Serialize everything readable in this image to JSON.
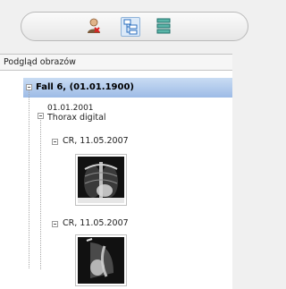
{
  "panel": {
    "title": "Podgląd obrazów"
  },
  "toolbar": {
    "icons": [
      "user-icon",
      "hierarchy-view-icon",
      "list-view-icon"
    ]
  },
  "tree": {
    "patient": {
      "label": "Fall 6,  (01.01.1900)"
    },
    "study": {
      "date": "01.01.2001",
      "description": "Thorax digital"
    },
    "series": [
      {
        "label": "CR, 11.05.2007",
        "thumbnail": "chest-xray-frontal"
      },
      {
        "label": "CR, 11.05.2007",
        "thumbnail": "chest-xray-lateral"
      }
    ]
  }
}
